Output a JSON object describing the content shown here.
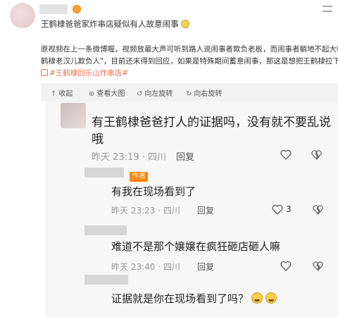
{
  "post": {
    "title": "王鹤棣爸爸家炸串店疑似有人故意闹事",
    "body_line1": "原视频在上一条微博喔，视频放最大声可听到路人说闹事者欺负老板，而闹事者躺地不起大喊\"王",
    "body_line2": "鹤棣老汉儿欺负人\"，目前还未得到回应，如果是特殊期间蓄意闹事，那这是想把王鹤棣拉下水吧",
    "hashtag": "#王鹤棣回乐山炸串店#"
  },
  "toolbar": {
    "collapse": "收起",
    "view_large": "查看大图",
    "rotate_left": "向左旋转",
    "rotate_right": "向右旋转"
  },
  "comments": [
    {
      "text_line1": "有王鹤棣爸爸打人的证据吗，没有就不要乱说",
      "text_line2": "哦",
      "meta": "昨天 23:19 · 四川",
      "reply": "回复",
      "likes": ""
    },
    {
      "badge": "作者",
      "text_line1": "有我在现场看到了",
      "meta": "昨天 23:23 · 四川",
      "reply": "回复",
      "likes": "3"
    },
    {
      "text_line1": "难道不是那个嬢嬢在疯狂砸店砸人嘛",
      "meta": "昨天 23:40 · 四川",
      "reply": "回复",
      "likes": ""
    },
    {
      "text_line1": "证据就是你在现场看到了吗？",
      "emoji": "laugh-cry-emoji"
    }
  ],
  "colors": {
    "hashtag": "#eb7350",
    "author_badge": "#ff8200",
    "panel_bg": "#f7f7f7"
  }
}
